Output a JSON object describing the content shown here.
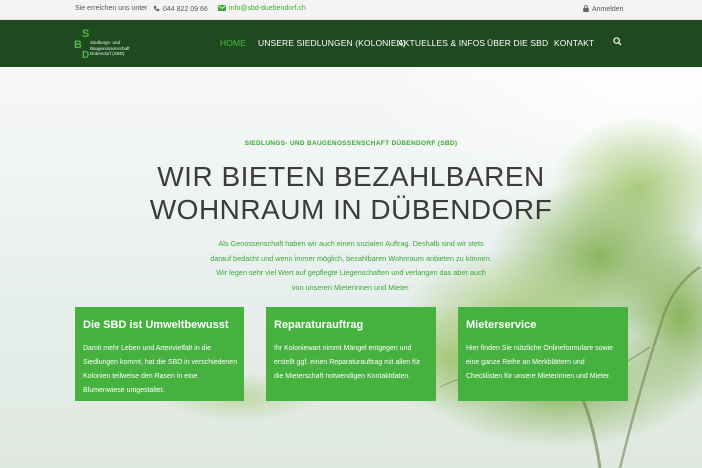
{
  "topbar": {
    "reach_label": "Sie erreichen uns unter",
    "phone": "044 822 09 66",
    "email": "info@sbd-duebendorf.ch",
    "login": "Anmelden"
  },
  "logo": {
    "letter_s": "S",
    "letter_b": "B",
    "letter_d": "D",
    "line1": "Siedlungs- und",
    "line2": "Baugenossenschaft",
    "line3": "Dübendorf (SBD)"
  },
  "nav": {
    "items": [
      {
        "label": "HOME"
      },
      {
        "label": "UNSERE SIEDLUNGEN (KOLONIEN)"
      },
      {
        "label": "AKTUELLES & INFOS"
      },
      {
        "label": "ÜBER DIE SBD"
      },
      {
        "label": "KONTAKT"
      }
    ],
    "active_color": "#4db848"
  },
  "hero": {
    "kicker": "SIEDLUNGS- UND BAUGENOSSENSCHAFT DÜBENDORF (SBD)",
    "headline_line1": "WIR BIETEN BEZAHLBAREN",
    "headline_line2": "WOHNRAUM IN DÜBENDORF",
    "intro": "Als Genossenschaft haben wir auch einen sozialen Auftrag. Deshalb sind wir stets darauf bedacht und wenn immer möglich, bezahlbaren Wohnraum anbieten zu können. Wir legen sehr viel Wert auf gepflegte Liegenschaften und verlangen das aber auch von unseren Mieterinnen und Mieter."
  },
  "cards": [
    {
      "title": "Die SBD ist Umweltbewusst",
      "text": "Damit mehr Leben und Artenvielfalt in die Siedlungen kommt, hat die SBD in verschiedenen Kolonien teilweise den Rasen in eine Blumenwiese umgestaltet."
    },
    {
      "title": "Reparaturauftrag",
      "text": "Ihr Koloniewart nimmt Mängel entgegen und erstellt ggf. einen Reparaturauftrag mit allen für die Mieterschaft notwendigen Kontaktdaten."
    },
    {
      "title": "Mieterservice",
      "text": "Hier finden Sie nützliche Onlineformulare sowie eine ganze Reihe an Merkblättern und Checklisten für unsere Mieterinnen und Mieter."
    }
  ],
  "colors": {
    "brand_green": "#46b13f",
    "header_dark": "#1f4a1f"
  }
}
